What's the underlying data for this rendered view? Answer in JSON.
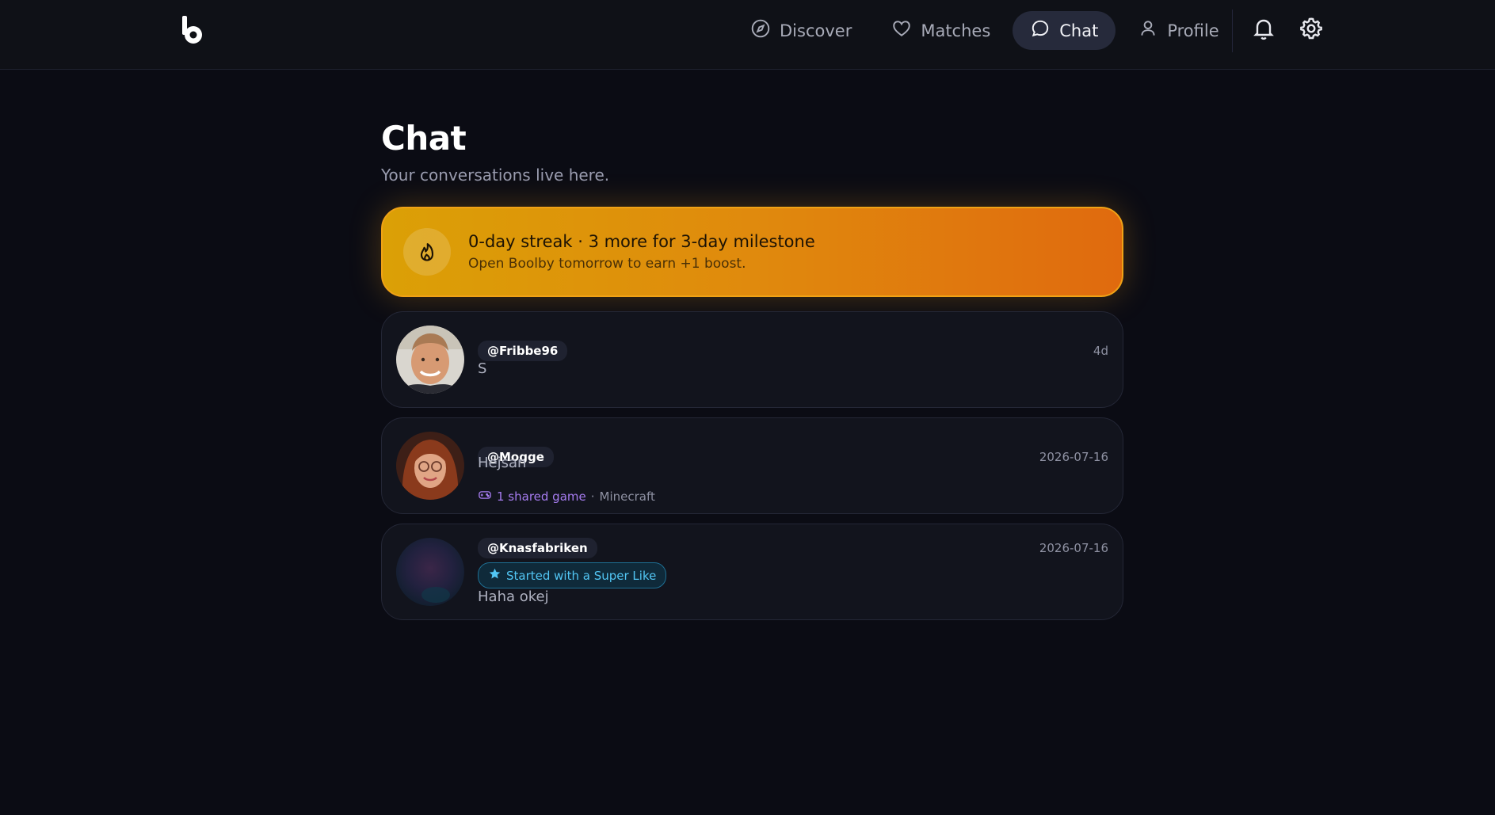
{
  "nav": {
    "items": [
      {
        "label": "Discover",
        "icon": "compass-icon"
      },
      {
        "label": "Matches",
        "icon": "heart-icon"
      },
      {
        "label": "Chat",
        "icon": "chat-bubble-icon",
        "active": true
      },
      {
        "label": "Profile",
        "icon": "user-icon"
      }
    ],
    "actions": [
      "bell-icon",
      "gear-icon"
    ]
  },
  "page": {
    "title": "Chat",
    "subtitle": "Your conversations live here."
  },
  "streak": {
    "title": "0-day streak · 3 more for 3-day milestone",
    "description": "Open Boolby tomorrow to earn +1 boost.",
    "icon": "flame-icon"
  },
  "chats": [
    {
      "handle": "@Fribbe96",
      "time": "4d",
      "preview": "S"
    },
    {
      "handle": "@Mogge",
      "time": "2026-07-16",
      "preview": "Hejsan",
      "shared_games": "1 shared game",
      "separator": "·",
      "game": "Minecraft"
    },
    {
      "handle": "@Knasfabriken",
      "time": "2026-07-16",
      "badge": "Started with a Super Like",
      "preview": "Haha okej"
    }
  ],
  "colors": {
    "background": "#0b0c14",
    "streak_start": "#dba006",
    "streak_end": "#e06a0e",
    "accent_purple": "#a67cf0",
    "accent_cyan": "#52c6f4"
  }
}
